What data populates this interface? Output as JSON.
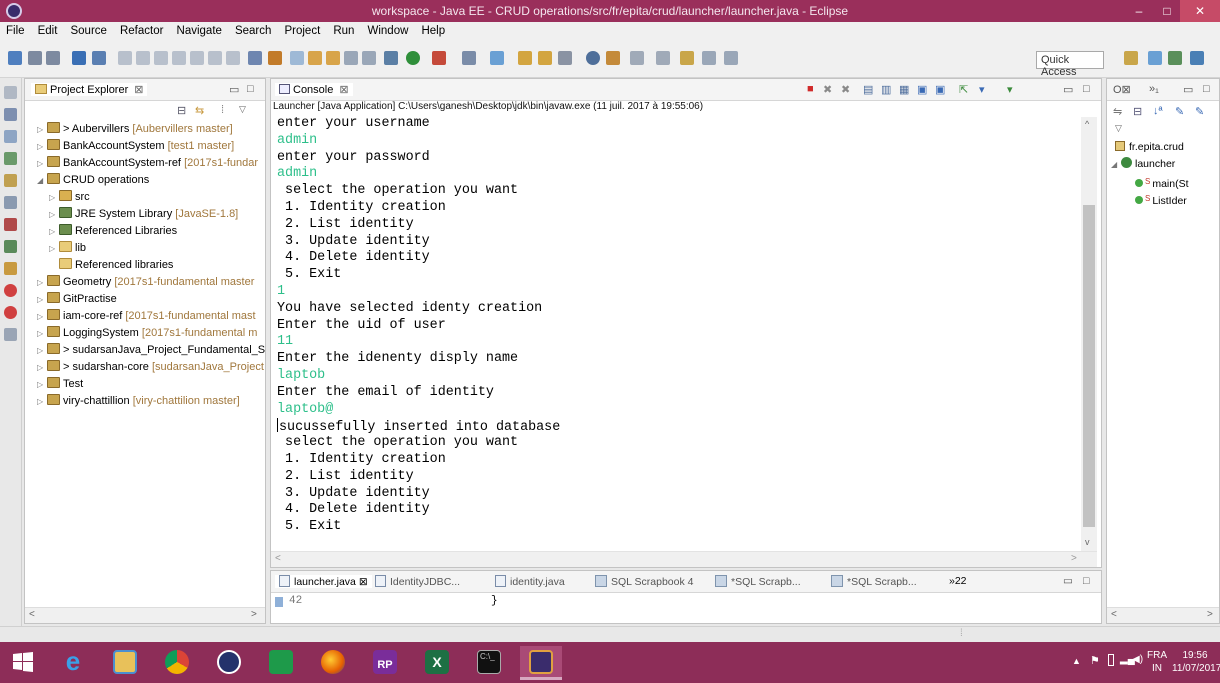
{
  "window": {
    "title": "workspace - Java EE - CRUD operations/src/fr/epita/crud/launcher/launcher.java - Eclipse",
    "min_glyph": "–",
    "max_glyph": "□",
    "close_glyph": "✕"
  },
  "menu": [
    "File",
    "Edit",
    "Source",
    "Refactor",
    "Navigate",
    "Search",
    "Project",
    "Run",
    "Window",
    "Help"
  ],
  "toolbar": {
    "quick_access": "Quick Access"
  },
  "project_explorer": {
    "tab_label": "Project Explorer",
    "items": [
      {
        "label": "> Aubervillers",
        "decoration": "[Aubervillers master]",
        "expander": "▷",
        "indent": 0,
        "icon": "proj"
      },
      {
        "label": "BankAccountSystem",
        "decoration": "[test1 master]",
        "expander": "▷",
        "indent": 0,
        "icon": "proj"
      },
      {
        "label": "BankAccountSystem-ref",
        "decoration": "[2017s1-fundar",
        "expander": "▷",
        "indent": 0,
        "icon": "proj"
      },
      {
        "label": "CRUD operations",
        "decoration": "",
        "expander": "◢",
        "indent": 0,
        "icon": "proj"
      },
      {
        "label": "src",
        "decoration": "",
        "expander": "▷",
        "indent": 1,
        "icon": "src"
      },
      {
        "label": "JRE System Library",
        "decoration": "[JavaSE-1.8]",
        "expander": "▷",
        "indent": 1,
        "icon": "lib"
      },
      {
        "label": "Referenced Libraries",
        "decoration": "",
        "expander": "▷",
        "indent": 1,
        "icon": "lib"
      },
      {
        "label": "lib",
        "decoration": "",
        "expander": "▷",
        "indent": 1,
        "icon": "folder"
      },
      {
        "label": "Referenced libraries",
        "decoration": "",
        "expander": "",
        "indent": 1,
        "icon": "folder"
      },
      {
        "label": "Geometry",
        "decoration": "[2017s1-fundamental master",
        "expander": "▷",
        "indent": 0,
        "icon": "proj"
      },
      {
        "label": "GitPractise",
        "decoration": "",
        "expander": "▷",
        "indent": 0,
        "icon": "proj"
      },
      {
        "label": "iam-core-ref",
        "decoration": "[2017s1-fundamental mast",
        "expander": "▷",
        "indent": 0,
        "icon": "proj"
      },
      {
        "label": "LoggingSystem",
        "decoration": "[2017s1-fundamental m",
        "expander": "▷",
        "indent": 0,
        "icon": "proj"
      },
      {
        "label": "> sudarsanJava_Project_Fundamental_S",
        "decoration": "",
        "expander": "▷",
        "indent": 0,
        "icon": "proj"
      },
      {
        "label": "> sudarshan-core",
        "decoration": "[sudarsanJava_Project",
        "expander": "▷",
        "indent": 0,
        "icon": "proj"
      },
      {
        "label": "Test",
        "decoration": "",
        "expander": "▷",
        "indent": 0,
        "icon": "proj"
      },
      {
        "label": "viry-chattillion",
        "decoration": "[viry-chattilion master]",
        "expander": "▷",
        "indent": 0,
        "icon": "proj"
      }
    ]
  },
  "console": {
    "tab_label": "Console",
    "status": "Launcher [Java Application] C:\\Users\\ganesh\\Desktop\\jdk\\bin\\javaw.exe (11 juil. 2017 à 19:55:06)",
    "lines": [
      {
        "text": "enter your username",
        "input": false
      },
      {
        "text": "admin",
        "input": true
      },
      {
        "text": "enter your password",
        "input": false
      },
      {
        "text": "admin",
        "input": true
      },
      {
        "text": " select the operation you want",
        "input": false
      },
      {
        "text": " 1. Identity creation",
        "input": false
      },
      {
        "text": " 2. List identity",
        "input": false
      },
      {
        "text": " 3. Update identity",
        "input": false
      },
      {
        "text": " 4. Delete identity",
        "input": false
      },
      {
        "text": " 5. Exit",
        "input": false
      },
      {
        "text": "1",
        "input": true
      },
      {
        "text": "You have selected identy creation",
        "input": false
      },
      {
        "text": "Enter the uid of user",
        "input": false
      },
      {
        "text": "11",
        "input": true
      },
      {
        "text": "Enter the idenenty disply name",
        "input": false
      },
      {
        "text": "laptob",
        "input": true
      },
      {
        "text": "Enter the email of identity",
        "input": false
      },
      {
        "text": "laptob@",
        "input": true
      },
      {
        "text": "sucussefully inserted into database",
        "input": false,
        "caret": true
      },
      {
        "text": " select the operation you want",
        "input": false
      },
      {
        "text": " 1. Identity creation",
        "input": false
      },
      {
        "text": " 2. List identity",
        "input": false
      },
      {
        "text": " 3. Update identity",
        "input": false
      },
      {
        "text": " 4. Delete identity",
        "input": false
      },
      {
        "text": " 5. Exit",
        "input": false
      }
    ]
  },
  "editor": {
    "tabs": [
      "launcher.java",
      "IdentityJDBC...",
      "identity.java",
      "SQL Scrapbook 4",
      "*SQL Scrapb...",
      "*SQL Scrapb..."
    ],
    "overflow": "»22",
    "line_number": "42",
    "code": "}"
  },
  "outline": {
    "items": [
      {
        "label": "fr.epita.crud",
        "kind": "package"
      },
      {
        "label": "launcher",
        "kind": "class"
      },
      {
        "label": "main(St",
        "kind": "method"
      },
      {
        "label": "ListIder",
        "kind": "method"
      }
    ]
  },
  "tray": {
    "lang_top": "FRA",
    "lang_bottom": "IN",
    "time": "19:56",
    "date": "11/07/2017"
  },
  "colors": {
    "title_bar": "#9a2f5b",
    "taskbar": "#8d2d58",
    "console_input": "#2dbf8a"
  }
}
